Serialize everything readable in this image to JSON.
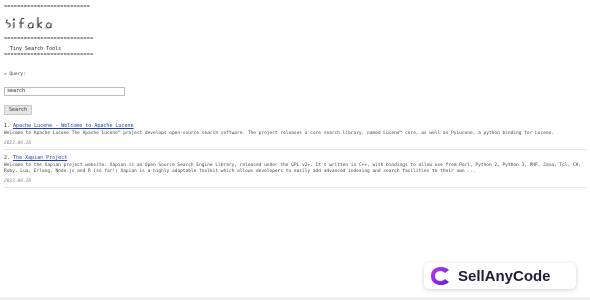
{
  "header": {
    "rule_top": "==========================",
    "logo_text": "sifaka",
    "rule_mid": "===========================",
    "tagline": "Tiny Search Tools",
    "rule_bottom": "==========================="
  },
  "search": {
    "label": "» Query:",
    "value": "search",
    "button_label": "Search"
  },
  "results": [
    {
      "num": "1.",
      "title": "Apache Lucene - Welcome to Apache Lucene",
      "snippet": "Welcome to Apache Lucene The Apache Lucene™ project develops open-source search software. The project releases a core search library, named Lucene™ core, as well as PyLucene, a python binding for Lucene.",
      "date": "2023.08.28"
    },
    {
      "num": "2.",
      "title": "The Xapian Project",
      "snippet": "Welcome to the Xapian project website. Xapian is an Open Source Search Engine Library, released under the GPL v2+. It's written in C++, with bindings to allow use from Perl, Python 2, Python 3, PHP, Java, Tcl, C#, Ruby, Lua, Erlang, Node.js and R (so far!) Xapian is a highly adaptable toolkit which allows developers to easily add advanced indexing and search facilities to their own ...",
      "date": "2023.08.28"
    }
  ],
  "badge": {
    "text": "SellAnyCode",
    "accent": "#7b2ff7"
  }
}
